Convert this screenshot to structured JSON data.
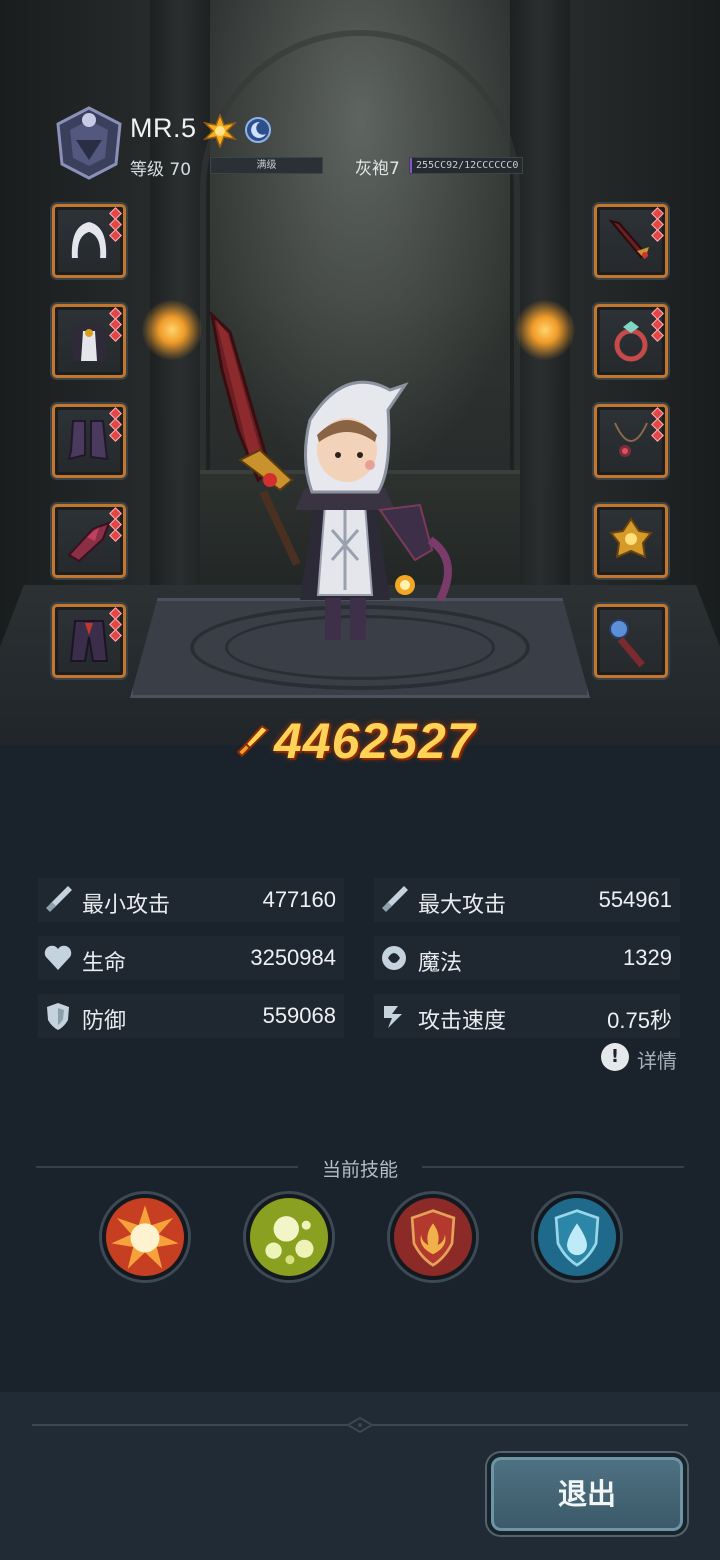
{
  "player": {
    "name": "MR.5",
    "level_label": "等级 70",
    "level_bar_text": "满级",
    "rank_label": "灰袍7",
    "rank_bar_text": "255CC92/12CCCCCC0",
    "rank_progress": 0.02,
    "icons": [
      "crest-shield-icon",
      "sun-badge-icon",
      "moon-badge-icon"
    ]
  },
  "equipment": {
    "left": [
      {
        "name": "hood",
        "pips": 3
      },
      {
        "name": "cloak",
        "pips": 3
      },
      {
        "name": "boots",
        "pips": 3
      },
      {
        "name": "gauntlet",
        "pips": 3
      },
      {
        "name": "leggings",
        "pips": 3
      }
    ],
    "right": [
      {
        "name": "sword",
        "pips": 3
      },
      {
        "name": "ring",
        "pips": 3
      },
      {
        "name": "necklace",
        "pips": 3
      },
      {
        "name": "emblem",
        "pips": 0
      },
      {
        "name": "staff",
        "pips": 0
      }
    ]
  },
  "power": {
    "value": "4462527"
  },
  "stats": [
    {
      "label": "最小攻击",
      "value": "477160",
      "icon": "sword-icon"
    },
    {
      "label": "最大攻击",
      "value": "554961",
      "icon": "sword-icon"
    },
    {
      "label": "生命",
      "value": "3250984",
      "icon": "heart-icon"
    },
    {
      "label": "魔法",
      "value": "1329",
      "icon": "magic-icon"
    },
    {
      "label": "防御",
      "value": "559068",
      "icon": "shield-icon"
    },
    {
      "label": "攻击速度",
      "value": "0.75秒",
      "icon": "speed-icon"
    }
  ],
  "detail": {
    "label": "详情",
    "icon_text": "!"
  },
  "skills": {
    "title": "当前技能",
    "items": [
      {
        "name": "explosion-skill",
        "color": "#e8572a"
      },
      {
        "name": "poison-bubbles-skill",
        "color": "#9db52a"
      },
      {
        "name": "fire-shield-skill",
        "color": "#a3302a"
      },
      {
        "name": "water-shield-skill",
        "color": "#2b7fa1"
      }
    ]
  },
  "exit_button": {
    "label": "退出"
  }
}
